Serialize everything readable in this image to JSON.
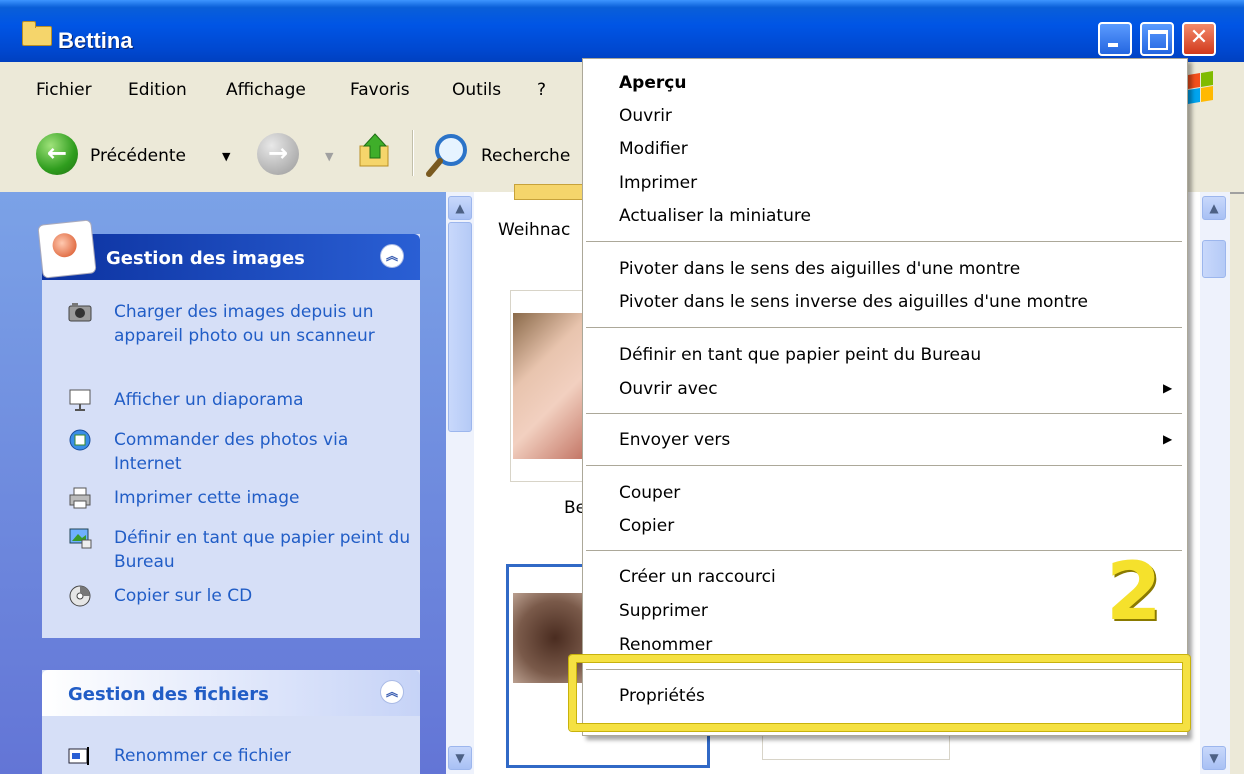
{
  "window": {
    "title": "Bettina"
  },
  "menubar": {
    "items": [
      "Fichier",
      "Edition",
      "Affichage",
      "Favoris",
      "Outils",
      "?"
    ]
  },
  "toolbar": {
    "back_label": "Précédente",
    "search_label": "Recherche"
  },
  "left_panel": {
    "image_tasks": {
      "title": "Gestion des images",
      "items": [
        {
          "label": "Charger des images depuis un appareil photo ou un scanneur",
          "icon": "camera-icon"
        },
        {
          "label": "Afficher un diaporama",
          "icon": "slideshow-icon"
        },
        {
          "label": "Commander des photos via Internet",
          "icon": "globe-icon"
        },
        {
          "label": "Imprimer cette image",
          "icon": "printer-icon"
        },
        {
          "label": "Définir en tant que papier peint du Bureau",
          "icon": "wallpaper-icon"
        },
        {
          "label": "Copier sur le CD",
          "icon": "cd-icon"
        }
      ]
    },
    "file_tasks": {
      "title": "Gestion des fichiers",
      "items": [
        {
          "label": "Renommer ce fichier",
          "icon": "rename-icon"
        }
      ]
    }
  },
  "files": {
    "folder_label": "Weihnac",
    "file_label": "Be"
  },
  "context_menu": {
    "items": [
      {
        "label": "Aperçu",
        "bold": true
      },
      {
        "label": "Ouvrir"
      },
      {
        "label": "Modifier"
      },
      {
        "label": "Imprimer"
      },
      {
        "label": "Actualiser la miniature"
      },
      {
        "label": "Pivoter dans le sens des aiguilles d'une montre"
      },
      {
        "label": "Pivoter dans le sens inverse des aiguilles d'une montre"
      },
      {
        "label": "Définir en tant que papier peint du Bureau"
      },
      {
        "label": "Ouvrir avec",
        "submenu": true
      },
      {
        "label": "Envoyer vers",
        "submenu": true
      },
      {
        "label": "Couper"
      },
      {
        "label": "Copier"
      },
      {
        "label": "Créer un raccourci"
      },
      {
        "label": "Supprimer"
      },
      {
        "label": "Renommer"
      },
      {
        "label": "Propriétés"
      }
    ]
  },
  "annotation": {
    "step_number": "2",
    "color": "#f5e142"
  },
  "colors": {
    "titlebar": "#0055e5",
    "task_link": "#215dc6",
    "panel_bg": "#d6dff7"
  }
}
